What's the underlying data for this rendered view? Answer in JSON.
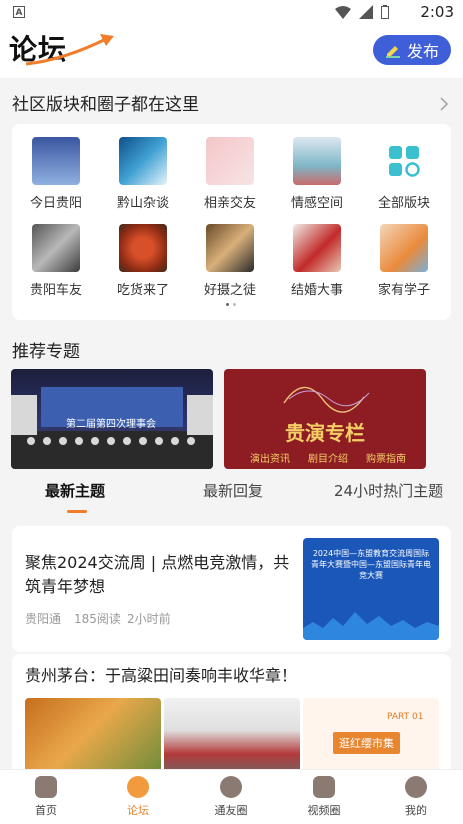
{
  "status_bar": {
    "time": "2:03"
  },
  "header": {
    "logo": "论坛",
    "publish_label": "发布"
  },
  "sections": {
    "community": "社区版块和圈子都在这里",
    "featured": "推荐专题"
  },
  "grid_items": [
    {
      "label": "今日贵阳"
    },
    {
      "label": "黔山杂谈"
    },
    {
      "label": "相亲交友"
    },
    {
      "label": "情感空间"
    },
    {
      "label": "全部版块"
    },
    {
      "label": "贵阳车友"
    },
    {
      "label": "吃货来了"
    },
    {
      "label": "好摄之徒"
    },
    {
      "label": "结婚大事"
    },
    {
      "label": "家有学子"
    }
  ],
  "banners": {
    "left_caption": "第二届第四次理事会",
    "right_title": "贵演专栏",
    "right_tags": [
      "演出资讯",
      "剧目介绍",
      "购票指南"
    ]
  },
  "tabs": [
    {
      "label": "最新主题"
    },
    {
      "label": "最新回复"
    },
    {
      "label": "24小时热门主题"
    }
  ],
  "posts": [
    {
      "title": "聚焦2024交流周 | 点燃电竞激情，共筑青年梦想",
      "author": "贵阳通",
      "reads": "185阅读",
      "time": "2小时前",
      "thumb_title": "2024中国—东盟教育交流周国际青年大赛暨中国—东盟国际青年电竞大赛"
    },
    {
      "title": "贵州茅台：于高粱田间奏响丰收华章！",
      "thumb3_title": "逛红缨市集",
      "thumb3_tag": "PART 01"
    }
  ],
  "bottom_nav": [
    {
      "label": "首页"
    },
    {
      "label": "论坛"
    },
    {
      "label": "通友圈"
    },
    {
      "label": "视频圈"
    },
    {
      "label": "我的"
    }
  ],
  "colors": {
    "accent": "#f07d2a",
    "publish_bg": "#3e5fd8",
    "nav_active": "#e8852f"
  }
}
